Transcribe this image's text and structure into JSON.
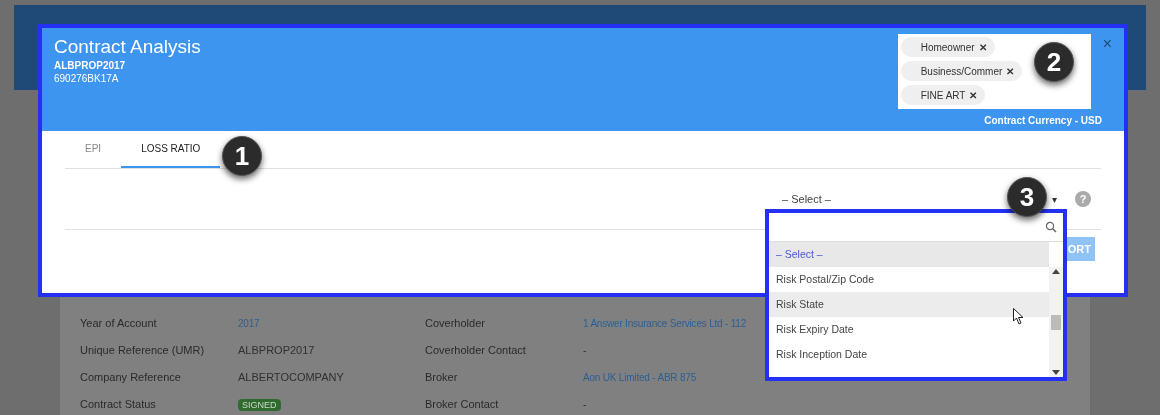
{
  "modal": {
    "title": "Contract Analysis",
    "subtitle": "ALBPROP2017",
    "reference": "690276BK17A",
    "tags": [
      {
        "label": "Homeowner",
        "remove": "✕"
      },
      {
        "label": "Business/Commer",
        "remove": "✕"
      },
      {
        "label": "FINE ART",
        "remove": "✕"
      }
    ],
    "close": "×",
    "currency": "Contract Currency - USD",
    "tabs": [
      {
        "label": "EPI",
        "selected": false
      },
      {
        "label": "LOSS RATIO",
        "selected": true
      }
    ],
    "select": {
      "value": "– Select –",
      "caret": "▾",
      "help": "?"
    },
    "export_button": "ORT"
  },
  "dropdown": {
    "options": [
      {
        "label": "– Select –",
        "selected": true,
        "hovered": false
      },
      {
        "label": "Risk Postal/Zip Code",
        "selected": false,
        "hovered": false
      },
      {
        "label": "Risk State",
        "selected": false,
        "hovered": true
      },
      {
        "label": "Risk Expiry Date",
        "selected": false,
        "hovered": false
      },
      {
        "label": "Risk Inception Date",
        "selected": false,
        "hovered": false
      }
    ]
  },
  "details": [
    {
      "left": {
        "label": "Year of Account",
        "value": "2017",
        "kind": "link"
      },
      "right": {
        "label": "Coverholder",
        "value": "1 Answer Insurance Services Ltd - 112",
        "kind": "link"
      }
    },
    {
      "left": {
        "label": "Unique Reference (UMR)",
        "value": "ALBPROP2017",
        "kind": "text"
      },
      "right": {
        "label": "Coverholder Contact",
        "value": "-",
        "kind": "text"
      }
    },
    {
      "left": {
        "label": "Company Reference",
        "value": "ALBERTOCOMPANY",
        "kind": "text"
      },
      "right": {
        "label": "Broker",
        "value": "Aon UK Limited - ABR 875",
        "kind": "link"
      }
    },
    {
      "left": {
        "label": "Contract Status",
        "value": "SIGNED",
        "kind": "badge"
      },
      "right": {
        "label": "Broker Contact",
        "value": "-",
        "kind": "text"
      }
    }
  ],
  "callouts": [
    "1",
    "2",
    "3"
  ]
}
